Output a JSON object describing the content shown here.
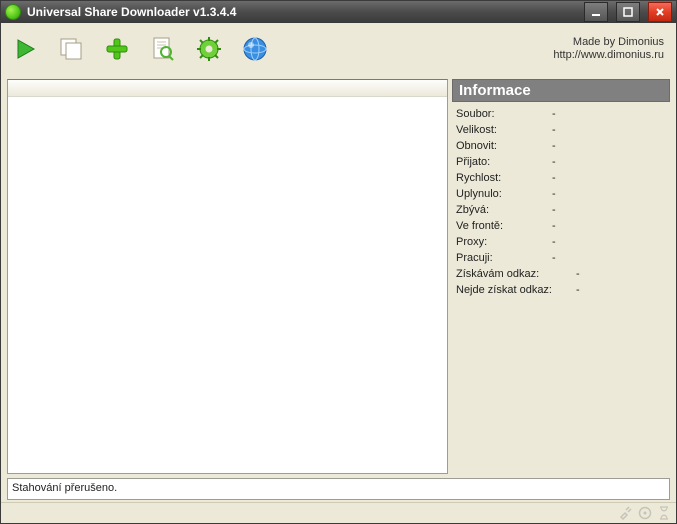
{
  "title": "Universal Share Downloader v1.3.4.4",
  "credits": {
    "line1": "Made by Dimonius",
    "line2": "http://www.dimonius.ru"
  },
  "toolbar": {
    "icons": [
      "play-icon",
      "copy-icon",
      "add-icon",
      "document-search-icon",
      "gear-icon",
      "globe-icon"
    ]
  },
  "info": {
    "title": "Informace",
    "rows": [
      {
        "label": "Soubor:",
        "value": "-"
      },
      {
        "label": "Velikost:",
        "value": "-"
      },
      {
        "label": "Obnovit:",
        "value": "-"
      },
      {
        "label": "Přijato:",
        "value": "-"
      },
      {
        "label": "Rychlost:",
        "value": "-"
      },
      {
        "label": "Uplynulo:",
        "value": "-"
      },
      {
        "label": "Zbývá:",
        "value": "-"
      },
      {
        "label": "Ve frontě:",
        "value": "-"
      },
      {
        "label": "Proxy:",
        "value": "-"
      },
      {
        "label": "Pracuji:",
        "value": "-"
      },
      {
        "label": "Získávám odkaz:",
        "value": "-"
      },
      {
        "label": "Nejde získat odkaz:",
        "value": "-"
      }
    ]
  },
  "log": "Stahování přerušeno.",
  "status_icons": [
    "plug-icon",
    "disc-icon",
    "hourglass-icon"
  ]
}
